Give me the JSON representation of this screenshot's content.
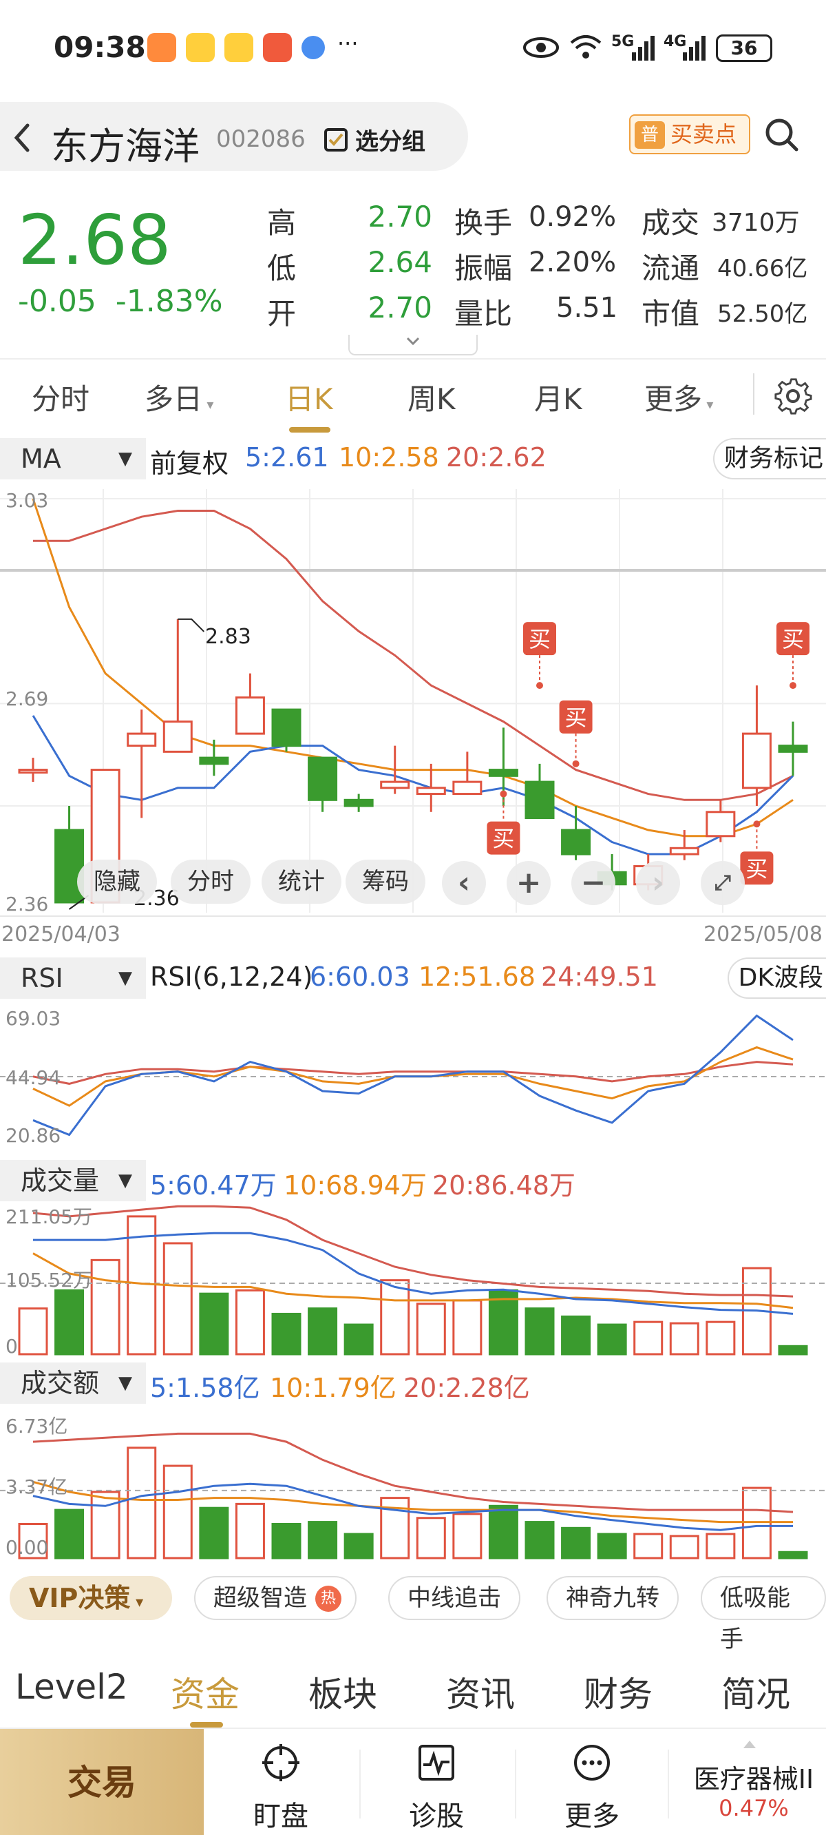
{
  "status_bar": {
    "time": "09:38",
    "signal_labels": [
      "5G",
      "4G"
    ],
    "battery": "36",
    "more": "···"
  },
  "header": {
    "back_icon": "chevron-left-icon",
    "stock_name": "东方海洋",
    "stock_code": "002086",
    "group_label": "选分组",
    "buy_sell_badge": "普",
    "buy_sell_label": "买卖点",
    "search_icon": "search-icon"
  },
  "quote": {
    "price": "2.68",
    "change": "-0.05",
    "change_pct": "-1.83%",
    "high_label": "高",
    "high": "2.70",
    "low_label": "低",
    "low": "2.64",
    "open_label": "开",
    "open": "2.70",
    "turnover_label": "换手",
    "turnover": "0.92%",
    "amplitude_label": "振幅",
    "amplitude": "2.20%",
    "volume_ratio_label": "量比",
    "volume_ratio": "5.51",
    "deal_label": "成交",
    "deal": "3710万",
    "float_label": "流通",
    "float": "40.66亿",
    "mktcap_label": "市值",
    "mktcap": "52.50亿"
  },
  "period_tabs": [
    {
      "label": "分时"
    },
    {
      "label": "多日"
    },
    {
      "label": "日K"
    },
    {
      "label": "周K"
    },
    {
      "label": "月K"
    },
    {
      "label": "更多"
    }
  ],
  "period_tabs_active": "日K",
  "ma_strip": {
    "selector": "MA",
    "adjust": "前复权",
    "ma5": "5:2.61",
    "ma10": "10:2.58",
    "ma20": "20:2.62",
    "right_tag": "财务标记"
  },
  "kline": {
    "axis_top": "3.03",
    "axis_mid": "2.69",
    "axis_bottom": "2.36",
    "high_mark": "2.83",
    "low_mark": "2.36",
    "date_start": "2025/04/03",
    "date_end": "2025/05/08",
    "buy_label": "买",
    "toolbar": [
      "隐藏",
      "分时",
      "统计",
      "筹码"
    ],
    "colors": {
      "up": "#e0533f",
      "down": "#3a9b2e",
      "ma5": "#3a6fd0",
      "ma10": "#e88a1a",
      "ma20": "#d45a50"
    }
  },
  "rsi_strip": {
    "selector": "RSI",
    "params": "RSI(6,12,24)",
    "r6": "6:60.03",
    "r12": "12:51.68",
    "r24": "24:49.51",
    "right_tag": "DK波段",
    "axis_top": "69.03",
    "axis_mid": "44.94",
    "axis_bottom": "20.86"
  },
  "vol_strip": {
    "selector": "成交量",
    "ma5": "5:60.47万",
    "ma10": "10:68.94万",
    "ma20": "20:86.48万",
    "axis_top": "211.05万",
    "axis_mid": "105.52万",
    "axis_bottom": "0"
  },
  "amt_strip": {
    "selector": "成交额",
    "ma5": "5:1.58亿",
    "ma10": "10:1.79亿",
    "ma20": "20:2.28亿",
    "axis_top": "6.73亿",
    "axis_mid": "3.37亿",
    "axis_bottom": "0.00"
  },
  "feature_bar": {
    "vip": "VIP决策",
    "chips": [
      "超级智造",
      "中线追击",
      "神奇九转",
      "低吸能手"
    ],
    "hot": "热"
  },
  "info_tabs": [
    {
      "label": "Level2"
    },
    {
      "label": "资金"
    },
    {
      "label": "板块"
    },
    {
      "label": "资讯"
    },
    {
      "label": "财务"
    },
    {
      "label": "简况"
    }
  ],
  "info_tabs_active": "资金",
  "bottom_nav": {
    "trade": "交易",
    "items": [
      {
        "label": "盯盘",
        "icon": "target-icon"
      },
      {
        "label": "诊股",
        "icon": "pulse-chart-icon"
      },
      {
        "label": "更多",
        "icon": "more-dots-icon"
      }
    ],
    "sector_name": "医疗器械II",
    "sector_pct": "0.47%"
  },
  "candles": [
    {
      "o": 2.58,
      "c": 2.58,
      "h": 2.6,
      "l": 2.56
    },
    {
      "o": 2.48,
      "c": 2.36,
      "h": 2.52,
      "l": 2.36
    },
    {
      "o": 2.36,
      "c": 2.58,
      "h": 2.58,
      "l": 2.36
    },
    {
      "o": 2.62,
      "c": 2.64,
      "h": 2.68,
      "l": 2.5
    },
    {
      "o": 2.61,
      "c": 2.66,
      "h": 2.83,
      "l": 2.61
    },
    {
      "o": 2.6,
      "c": 2.59,
      "h": 2.63,
      "l": 2.57
    },
    {
      "o": 2.64,
      "c": 2.7,
      "h": 2.74,
      "l": 2.64
    },
    {
      "o": 2.68,
      "c": 2.62,
      "h": 2.68,
      "l": 2.61
    },
    {
      "o": 2.6,
      "c": 2.53,
      "h": 2.6,
      "l": 2.51
    },
    {
      "o": 2.53,
      "c": 2.52,
      "h": 2.54,
      "l": 2.51
    },
    {
      "o": 2.55,
      "c": 2.56,
      "h": 2.62,
      "l": 2.54
    },
    {
      "o": 2.54,
      "c": 2.55,
      "h": 2.59,
      "l": 2.51
    },
    {
      "o": 2.54,
      "c": 2.56,
      "h": 2.61,
      "l": 2.54
    },
    {
      "o": 2.58,
      "c": 2.57,
      "h": 2.65,
      "l": 2.52
    },
    {
      "o": 2.56,
      "c": 2.5,
      "h": 2.59,
      "l": 2.5
    },
    {
      "o": 2.48,
      "c": 2.44,
      "h": 2.52,
      "l": 2.43
    },
    {
      "o": 2.41,
      "c": 2.39,
      "h": 2.44,
      "l": 2.38
    },
    {
      "o": 2.39,
      "c": 2.42,
      "h": 2.44,
      "l": 2.38
    },
    {
      "o": 2.44,
      "c": 2.45,
      "h": 2.48,
      "l": 2.43
    },
    {
      "o": 2.47,
      "c": 2.51,
      "h": 2.53,
      "l": 2.46
    },
    {
      "o": 2.55,
      "c": 2.64,
      "h": 2.72,
      "l": 2.52
    },
    {
      "o": 2.62,
      "c": 2.61,
      "h": 2.66,
      "l": 2.57
    }
  ],
  "ma_series": {
    "ma5": [
      2.67,
      2.57,
      2.54,
      2.53,
      2.55,
      2.55,
      2.61,
      2.62,
      2.62,
      2.58,
      2.57,
      2.55,
      2.54,
      2.55,
      2.53,
      2.5,
      2.46,
      2.44,
      2.44,
      2.47,
      2.51,
      2.57
    ],
    "ma10": [
      3.03,
      2.85,
      2.74,
      2.69,
      2.64,
      2.62,
      2.62,
      2.61,
      2.6,
      2.59,
      2.58,
      2.58,
      2.58,
      2.57,
      2.55,
      2.52,
      2.5,
      2.48,
      2.47,
      2.47,
      2.49,
      2.53
    ],
    "ma20": [
      2.96,
      2.96,
      2.98,
      3.0,
      3.01,
      3.01,
      2.98,
      2.93,
      2.86,
      2.81,
      2.77,
      2.72,
      2.69,
      2.66,
      2.62,
      2.58,
      2.56,
      2.54,
      2.53,
      2.53,
      2.54,
      2.57
    ]
  },
  "buy_markers": [
    {
      "index": 13,
      "price": 2.54,
      "side": "below"
    },
    {
      "index": 14,
      "price": 2.72,
      "side": "above"
    },
    {
      "index": 15,
      "price": 2.59,
      "side": "above"
    },
    {
      "index": 20,
      "price": 2.49,
      "side": "below"
    },
    {
      "index": 21,
      "price": 2.72,
      "side": "above"
    }
  ],
  "rsi_series": {
    "rsi6": [
      27,
      21,
      41,
      46,
      47,
      43,
      51,
      47,
      39,
      38,
      45,
      45,
      47,
      47,
      37,
      31,
      26,
      39,
      42,
      55,
      70,
      60
    ],
    "rsi12": [
      40,
      33,
      43,
      46,
      47,
      45,
      49,
      47,
      43,
      42,
      45,
      45,
      46,
      46,
      42,
      39,
      36,
      41,
      43,
      51,
      57,
      52
    ],
    "rsi24": [
      45,
      42,
      46,
      48,
      48,
      47,
      49,
      48,
      47,
      46,
      47,
      47,
      47,
      47,
      46,
      45,
      43,
      45,
      46,
      49,
      51,
      50
    ]
  },
  "volume": {
    "values": [
      68,
      95,
      140,
      205,
      165,
      90,
      95,
      60,
      68,
      44,
      110,
      75,
      80,
      95,
      68,
      56,
      44,
      48,
      46,
      48,
      128,
      12
    ],
    "ma5": [
      170,
      170,
      170,
      175,
      178,
      180,
      180,
      170,
      155,
      120,
      100,
      90,
      95,
      96,
      90,
      82,
      80,
      75,
      70,
      66,
      65,
      60
    ],
    "ma10": [
      150,
      120,
      110,
      105,
      102,
      100,
      100,
      90,
      86,
      84,
      80,
      80,
      80,
      82,
      82,
      84,
      82,
      78,
      76,
      76,
      75,
      69
    ],
    "ma20": [
      210,
      205,
      210,
      215,
      220,
      220,
      218,
      200,
      170,
      150,
      130,
      118,
      110,
      105,
      100,
      98,
      96,
      94,
      90,
      88,
      88,
      86
    ]
  },
  "amount": {
    "values": [
      1.7,
      2.4,
      3.3,
      5.5,
      4.6,
      2.5,
      2.7,
      1.7,
      1.8,
      1.2,
      3.0,
      2.0,
      2.2,
      2.6,
      1.8,
      1.5,
      1.2,
      1.2,
      1.1,
      1.2,
      3.5,
      0.3
    ],
    "ma5": [
      3.1,
      2.7,
      2.6,
      3.1,
      3.3,
      3.6,
      3.7,
      3.6,
      3.1,
      2.6,
      2.4,
      2.2,
      2.3,
      2.4,
      2.4,
      2.1,
      1.9,
      1.7,
      1.5,
      1.4,
      1.6,
      1.6
    ],
    "ma10": [
      3.8,
      3.3,
      3.0,
      2.9,
      2.9,
      3.0,
      3.0,
      2.9,
      2.7,
      2.6,
      2.5,
      2.4,
      2.4,
      2.4,
      2.4,
      2.3,
      2.1,
      2.0,
      1.9,
      1.8,
      1.8,
      1.8
    ],
    "ma20": [
      5.8,
      5.9,
      6.0,
      6.1,
      6.2,
      6.2,
      6.2,
      5.8,
      4.9,
      4.2,
      3.6,
      3.3,
      3.0,
      2.8,
      2.7,
      2.6,
      2.5,
      2.4,
      2.4,
      2.4,
      2.4,
      2.3
    ]
  }
}
